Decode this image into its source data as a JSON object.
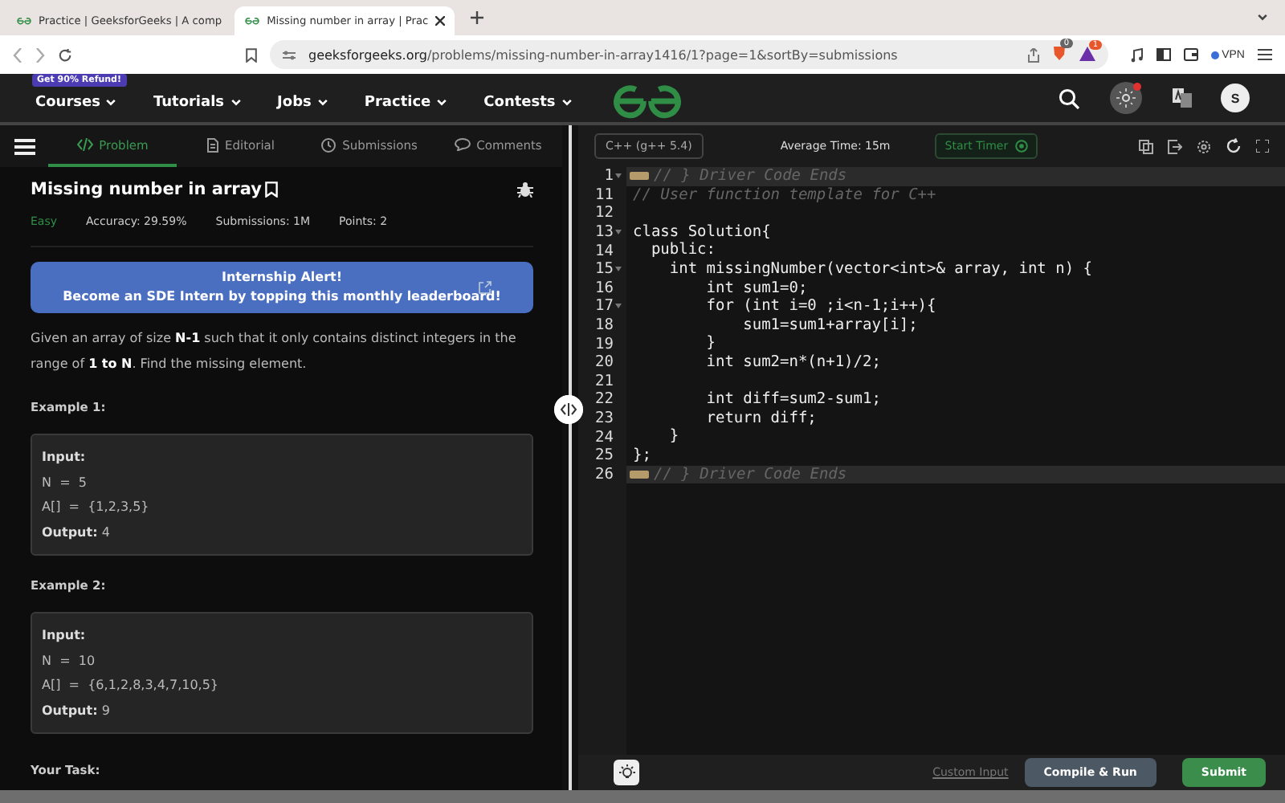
{
  "browser": {
    "tabs": [
      {
        "title": "Practice | GeeksforGeeks | A comp",
        "selected": false
      },
      {
        "title": "Missing number in array | Prac",
        "selected": true
      }
    ],
    "url_host": "geeksforgeeks.org",
    "url_path": "/problems/missing-number-in-array1416/1?page=1&sortBy=submissions",
    "shield_count": "0",
    "alert_count": "1",
    "vpn": "VPN"
  },
  "site_nav": {
    "promo": "Get 90% Refund!",
    "items": [
      "Courses",
      "Tutorials",
      "Jobs",
      "Practice",
      "Contests"
    ],
    "avatar": "S"
  },
  "problem_tabs": [
    {
      "label": "Problem",
      "selected": true
    },
    {
      "label": "Editorial",
      "selected": false
    },
    {
      "label": "Submissions",
      "selected": false
    },
    {
      "label": "Comments",
      "selected": false
    }
  ],
  "problem": {
    "title": "Missing number in array",
    "difficulty": "Easy",
    "accuracy": "Accuracy: 29.59%",
    "submissions": "Submissions: 1M",
    "points": "Points: 2",
    "banner": {
      "title": "Internship Alert!",
      "text": "Become an SDE Intern by topping this monthly leaderboard!"
    },
    "description": "Given an array of size **N-1** such that it only contains distinct integers in the range of **1 to N**. Find the missing element.",
    "examples": [
      {
        "heading": "Example 1:",
        "lines": [
          {
            "kind": "label",
            "text": "Input:"
          },
          {
            "kind": "plain",
            "text": "N  =  5"
          },
          {
            "kind": "plain",
            "text": "A[]  =  {1,2,3,5}"
          },
          {
            "kind": "result",
            "label": "Output:",
            "text": "4"
          }
        ]
      },
      {
        "heading": "Example 2:",
        "lines": [
          {
            "kind": "label",
            "text": "Input:"
          },
          {
            "kind": "plain",
            "text": "N  =  10"
          },
          {
            "kind": "plain",
            "text": "A[]  =  {6,1,2,8,3,4,7,10,5}"
          },
          {
            "kind": "result",
            "label": "Output:",
            "text": "9"
          }
        ]
      }
    ],
    "next_heading": "Your Task:"
  },
  "editor": {
    "language": "C++ (g++ 5.4)",
    "average_time": "Average Time: 15m",
    "timer_button": "Start Timer",
    "lines": [
      {
        "no": "1",
        "foldable": true,
        "folded": true,
        "kind": "comment",
        "text": "// } Driver Code Ends"
      },
      {
        "no": "11",
        "foldable": false,
        "folded": false,
        "kind": "comment",
        "text": "// User function template for C++"
      },
      {
        "no": "12",
        "foldable": false,
        "folded": false,
        "kind": "blank"
      },
      {
        "no": "13",
        "foldable": true,
        "folded": false,
        "kind": "code",
        "text": "class Solution{"
      },
      {
        "no": "14",
        "foldable": false,
        "folded": false,
        "kind": "code",
        "text": "  public:"
      },
      {
        "no": "15",
        "foldable": true,
        "folded": false,
        "kind": "code",
        "text": "    int missingNumber(vector<int>& array, int n) {"
      },
      {
        "no": "16",
        "foldable": false,
        "folded": false,
        "kind": "code",
        "text": "        int sum1=0;"
      },
      {
        "no": "17",
        "foldable": true,
        "folded": false,
        "kind": "code",
        "text": "        for (int i=0 ;i<n-1;i++){"
      },
      {
        "no": "18",
        "foldable": false,
        "folded": false,
        "kind": "code",
        "text": "            sum1=sum1+array[i];"
      },
      {
        "no": "19",
        "foldable": false,
        "folded": false,
        "kind": "code",
        "text": "        }"
      },
      {
        "no": "20",
        "foldable": false,
        "folded": false,
        "kind": "code",
        "text": "        int sum2=n*(n+1)/2;"
      },
      {
        "no": "21",
        "foldable": false,
        "folded": false,
        "kind": "blank"
      },
      {
        "no": "22",
        "foldable": false,
        "folded": false,
        "kind": "code",
        "text": "        int diff=sum2-sum1;"
      },
      {
        "no": "23",
        "foldable": false,
        "folded": false,
        "kind": "code",
        "text": "        return diff;"
      },
      {
        "no": "24",
        "foldable": false,
        "folded": false,
        "kind": "code",
        "text": "    }"
      },
      {
        "no": "25",
        "foldable": false,
        "folded": false,
        "kind": "code",
        "text": "};"
      },
      {
        "no": "26",
        "foldable": false,
        "folded": true,
        "kind": "comment",
        "text": "// } Driver Code Ends"
      }
    ],
    "custom_input": "Custom Input",
    "compile_button": "Compile & Run",
    "submit_button": "Submit"
  }
}
